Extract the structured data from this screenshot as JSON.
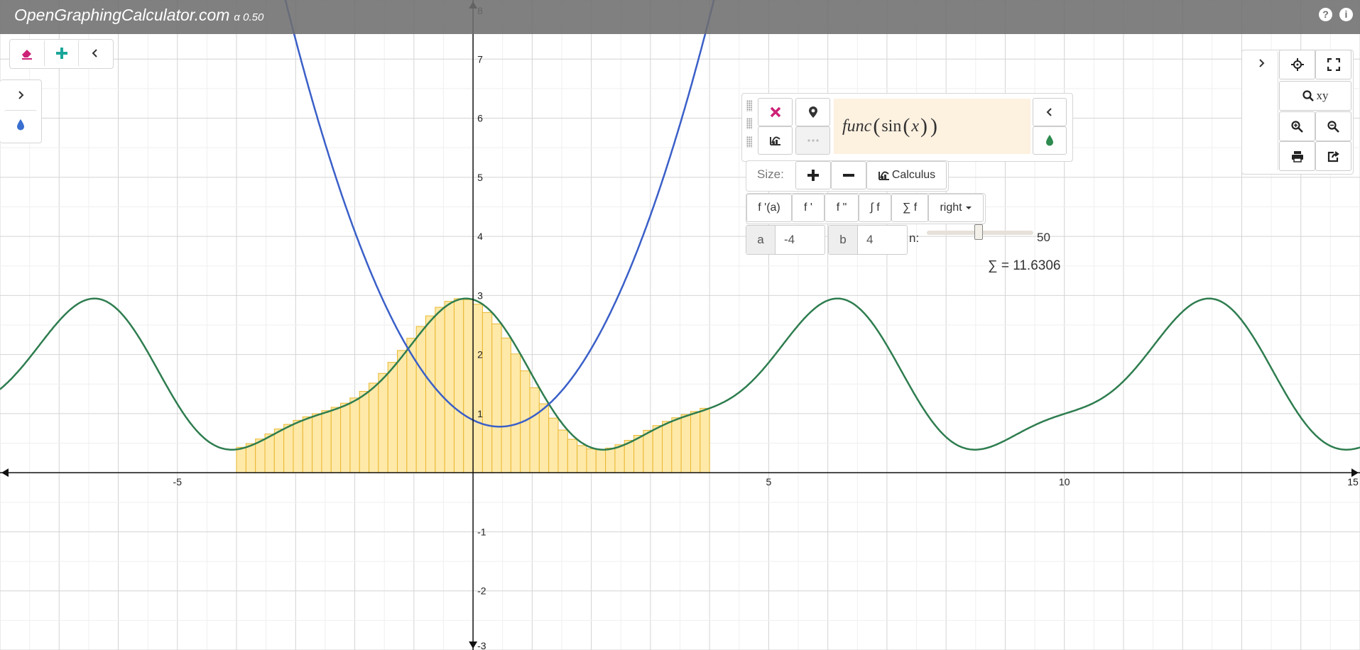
{
  "header": {
    "brand": "OpenGraphingCalculator.com",
    "version": "α 0.50",
    "help_icon": "question-icon",
    "info_icon": "info-icon"
  },
  "toolbar_left": {
    "items": [
      "eraser-icon",
      "plus-icon",
      "chevron-left-icon"
    ]
  },
  "side_panel": {
    "items": [
      "chevron-right-icon",
      "droplet-icon"
    ]
  },
  "function_panel": {
    "expression": {
      "fn": "func",
      "inner": "sin",
      "var": "x"
    },
    "size_label": "Size:",
    "calculus_label": "Calculus",
    "derivative_buttons": [
      "f '(a)",
      "f '",
      "f \"",
      "∫ f",
      "∑ f"
    ],
    "riemann_mode": "right",
    "a_label": "a",
    "a_value": "-4",
    "b_label": "b",
    "b_value": "4",
    "n_label": "n:",
    "n_value": "50",
    "sum_text": "∑ = 11.6306"
  },
  "view_panel": {
    "zoom_xy_label": "xy"
  },
  "colors": {
    "green_curve": "#2e7d4f",
    "blue_curve": "#3a5fc8",
    "riemann_fill": "#ffe9a8",
    "riemann_stroke": "#e8b830",
    "accent_pink": "#cc2277",
    "accent_teal": "#1aa79a"
  },
  "axes": {
    "x_ticks": [
      "-5",
      "5",
      "10",
      "15"
    ],
    "y_ticks": [
      "8",
      "7",
      "6",
      "5",
      "4",
      "3",
      "2",
      "1",
      "-1",
      "-2",
      "-3"
    ]
  },
  "chart_data": {
    "type": "line",
    "xlim": [
      -8,
      15
    ],
    "ylim": [
      -3,
      8
    ],
    "grid": true,
    "series": [
      {
        "color": "#2e7d4f",
        "function": "func(sin(x))"
      },
      {
        "color": "#3a5fc8",
        "function": "parabola"
      }
    ],
    "riemann": {
      "a": -4,
      "b": 4,
      "n": 50,
      "mode": "right",
      "sum": 11.6306
    }
  }
}
